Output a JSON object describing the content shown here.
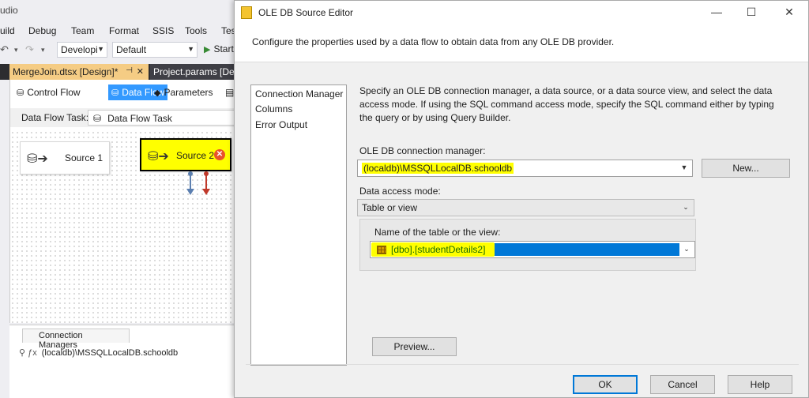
{
  "ide": {
    "title_fragment": "udio",
    "menu": [
      "uild",
      "Debug",
      "Team",
      "Format",
      "SSIS",
      "Tools",
      "Tes"
    ],
    "toolbar": {
      "config_combo": "Developi",
      "platform_combo": "Default",
      "start_label": "Start"
    },
    "doc_tabs": {
      "active": "MergeJoin.dtsx [Design]*",
      "other": "Project.params [Design]"
    },
    "designer_tabs": [
      "Control Flow",
      "Data Flow",
      "Parameters"
    ],
    "data_flow_task_label": "Data Flow Task:",
    "data_flow_task_value": "Data Flow Task",
    "nodes": [
      {
        "label": "Source 1",
        "selected": false
      },
      {
        "label": "Source 2",
        "selected": true,
        "error": true
      }
    ],
    "connection_managers": {
      "tab_label": "Connection Managers",
      "items": [
        "(localdb)\\MSSQLLocalDB.schooldb"
      ]
    },
    "arrow_colors": {
      "data_path": "#5b7fb0",
      "error_path": "#c0392b"
    }
  },
  "dialog": {
    "title": "OLE DB Source Editor",
    "header_text": "Configure the properties used by a data flow to obtain data from any OLE DB provider.",
    "nav_items": [
      "Connection Manager",
      "Columns",
      "Error Output"
    ],
    "description": "Specify an OLE DB connection manager, a data source, or a data source view, and select the data access mode. If using the SQL command access mode, specify the SQL command either by typing the query or by using Query Builder.",
    "connection_manager_label": "OLE DB connection manager:",
    "connection_manager_value": "(localdb)\\MSSQLLocalDB.schooldb",
    "new_button": "New...",
    "data_access_mode_label": "Data access mode:",
    "data_access_mode_value": "Table or view",
    "table_label": "Name of the table or the view:",
    "table_value": "[dbo].[studentDetails2]",
    "preview_button": "Preview...",
    "ok_button": "OK",
    "cancel_button": "Cancel",
    "help_button": "Help",
    "highlight_color": "#ffff00",
    "selection_color": "#0078d7"
  }
}
